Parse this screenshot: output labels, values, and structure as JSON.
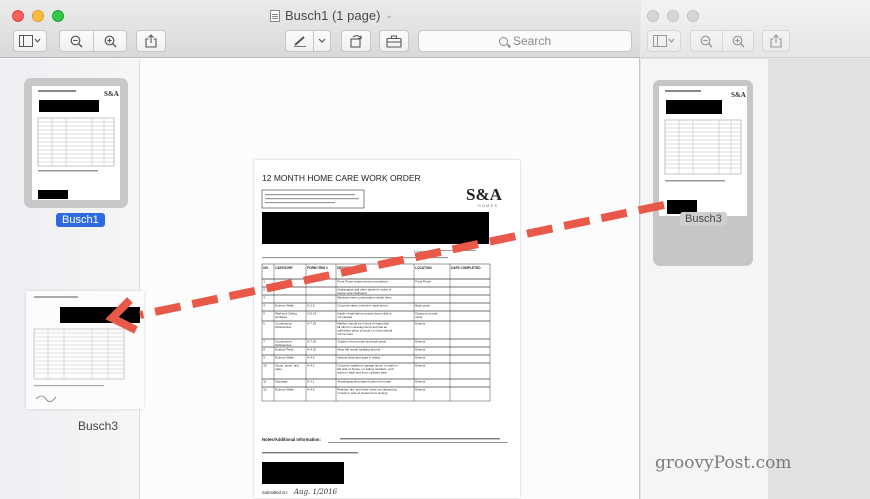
{
  "window": {
    "title": "Busch1 (1 page)"
  },
  "toolbar": {
    "search_placeholder": "Search"
  },
  "sidebar": {
    "selected_thumbnail_label": "Busch1",
    "dragged_thumbnail_label": "Busch3"
  },
  "second_window": {
    "thumbnail_label": "Busch3"
  },
  "document": {
    "heading": "12 MONTH HOME CARE WORK ORDER",
    "logo": "S&A",
    "logo_sub": "HOMES",
    "notice": "Please note that the form must be postmarked no later than 13 months after your closing date. Work items cannot guarantee completion of items received after this form.",
    "intro": "Please make any changes or corrections to the information above. We would be happy to assist you.",
    "closing_label": "Closing Date:",
    "columns": [
      "NO.",
      "CATEGORY",
      "FORM ITEM #",
      "DESCRIPTION",
      "LOCATION",
      "DATE COMPLETED"
    ],
    "rows": [
      [
        "1",
        "",
        "A-12",
        "Front Porch exterior items not painted",
        "Front Porch",
        ""
      ],
      [
        "2",
        "",
        "",
        "Hydrangeas and other plants for sides of house never delivered",
        "",
        ""
      ],
      [
        "3",
        "",
        "",
        "Windows have condensation inside them",
        "",
        ""
      ],
      [
        "4",
        "Exterior Walls",
        "A-2.6",
        "Concrete steps on brick in back porch",
        "Back porch",
        ""
      ],
      [
        "5",
        "Wall and Ceiling Surfaces",
        "A-5.24",
        "Inside of wall where pocket doors slide is not painted",
        "Dining room and study",
        ""
      ],
      [
        "6",
        "Construction Deficiencies",
        "A-7.18",
        "Mailbox should be in front of steps (like all others in development) and has an unfinished piece of wood on it that should not be there",
        "Exterior",
        ""
      ],
      [
        "7",
        "Construction Deficiencies",
        "A-7.18",
        "Cracks in front porch and back porch",
        "Exterior",
        ""
      ],
      [
        "8",
        "Exterior Paint",
        "A-4.22",
        "Hose bib needs caulking around",
        "Exterior",
        ""
      ],
      [
        "9",
        "Exterior Walls",
        "A-4.6",
        "Various chips and gaps in siding",
        "Exterior",
        ""
      ],
      [
        "10",
        "Stoop, porch, and patio",
        "A-4.2",
        "Concrete spalled on garage doors, on wall on left side of house, on siding, windows, and doors in back and front, upstairs back",
        "Exterior",
        ""
      ],
      [
        "11",
        "Drainage",
        "A-1.1",
        "Standing/pooling water bottom front step",
        "Exterior",
        ""
      ],
      [
        "12",
        "Exterior Walls",
        "A-4.6",
        "Residue, dirt, and other mess not cleaned up in back or side of houses from closing",
        "Exterior",
        ""
      ]
    ],
    "notes_label": "Notes/Additional Information:",
    "notes_text": "Exclusion of outstanding items from 3-month home care work order on this work order do not imply satisfaction or completion.",
    "submitted_label": "Submitted on:",
    "submitted_value": "Aug. 1/2016"
  },
  "watermark": "groovyPost.com",
  "colors": {
    "selection": "#2f6bde",
    "arrow": "#e8594a"
  }
}
